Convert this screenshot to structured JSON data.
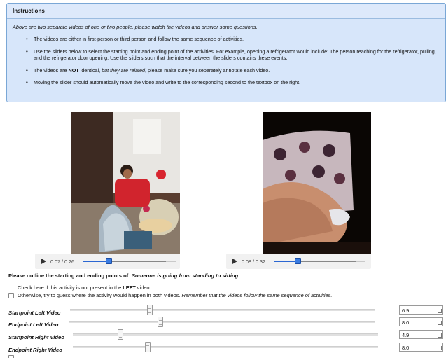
{
  "instructions": {
    "title": "Instructions",
    "intro": "Above are two separate videos of one or two people, please watch the videos and answer some questions.",
    "bullet1": "The videos are either in first-person or third person and follow the same sequence of activities.",
    "bullet2": "Use the sliders below to select the starting point and ending point of the activities. For example, opening a refrigerator would include: The person reaching for the refrigerator, pulling, and the refrigerator door opening. Use the sliders such that the interval between the sliders contains these events.",
    "bullet3_pre": "The videos are ",
    "bullet3_bold": "NOT",
    "bullet3_mid": " identical, ",
    "bullet3_italic": "but they are related",
    "bullet3_post": ", please make sure you seperately annotate each video.",
    "bullet4": "Moving the slider should automatically move the video and write to the corresponding second to the textbox on the right."
  },
  "left_video": {
    "time": "0:07 / 0:26",
    "progress": 0.27
  },
  "right_video": {
    "time": "0:08 / 0:32",
    "progress": 0.25
  },
  "question": {
    "prefix": "Please outline the starting and ending points of: ",
    "activity": "Someone is going from standing to sitting"
  },
  "not_present": {
    "pre": "Check here if this activity is not present in the ",
    "bold": "LEFT",
    "post": " video"
  },
  "otherwise": {
    "text": "Otherwise, try to guess where the activity would happen in both videos. ",
    "italic": "Remember that the videos follow the same sequence of activities."
  },
  "sliders": {
    "start_left_label": "Startpoint Left Video",
    "end_left_label": "Endpoint  Left Video",
    "start_right_label": "Startpoint Right Video",
    "end_right_label": "Endpoint  Right Video",
    "start_left_value": "6.9",
    "end_left_value": "8.0",
    "start_right_value": "4.9",
    "end_right_value": "8.0"
  }
}
